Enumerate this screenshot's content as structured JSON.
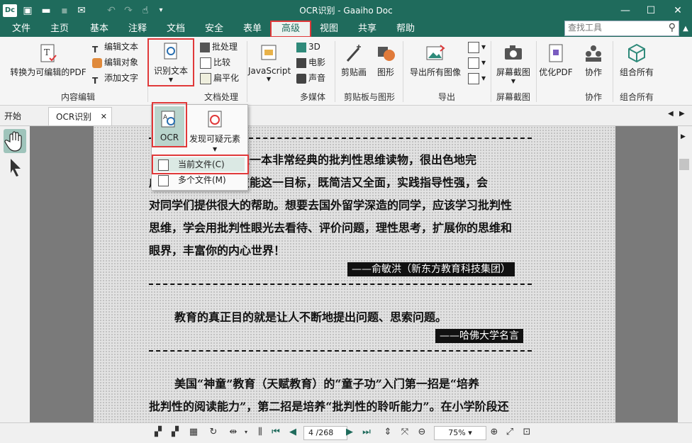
{
  "titlebar": {
    "logo": "Dc",
    "title": "OCR识别 - Gaaiho Doc",
    "minimize": "—",
    "maximize": "☐",
    "close": "✕"
  },
  "quick_access": [
    {
      "name": "new-doc-icon",
      "glyph": "▣"
    },
    {
      "name": "open-folder-icon",
      "glyph": "▬"
    },
    {
      "name": "save-icon",
      "glyph": "▪"
    },
    {
      "name": "email-icon",
      "glyph": "✉"
    },
    {
      "name": "undo-icon",
      "glyph": "↶"
    },
    {
      "name": "redo-icon",
      "glyph": "↷"
    },
    {
      "name": "hand-tool-icon",
      "glyph": "☝"
    },
    {
      "name": "customize-icon",
      "glyph": "▾"
    }
  ],
  "menu": {
    "items": [
      "文件",
      "主页",
      "基本",
      "注释",
      "文档",
      "安全",
      "表单",
      "高级",
      "视图",
      "共享",
      "帮助"
    ],
    "active": "高级",
    "search_placeholder": "查找工具"
  },
  "ribbon": {
    "convert_editable": "转换为可编辑的PDF",
    "edit_text": "编辑文本",
    "edit_object": "编辑对象",
    "add_text": "添加文字",
    "group_content_edit": "内容编辑",
    "ocr_text": "识别文本",
    "batch": "批处理",
    "compare": "比较",
    "flatten": "扁平化",
    "group_doc_process": "文档处理",
    "javascript": "JavaScript",
    "threed": "3D",
    "movie": "电影",
    "sound": "声音",
    "group_multimedia": "多媒体",
    "clip_art": "剪贴画",
    "shapes": "图形",
    "group_clip": "剪贴板与图形",
    "export_images": "导出所有图像",
    "group_export": "导出",
    "screenshot": "屏幕截图",
    "group_screenshot": "屏幕截图",
    "optimize": "优化PDF",
    "collab": "协作",
    "group_collab": "协作",
    "combine_all": "组合所有",
    "group_combine": "组合所有"
  },
  "tabs": {
    "start": "开始",
    "ocr": "OCR识别",
    "close": "✕"
  },
  "dropdown": {
    "ocr": "OCR",
    "find_suspects": "发现可疑元素",
    "current_file": "当前文件(C)",
    "multiple_files": "多个文件(M)"
  },
  "document": {
    "line1": "问》是一本非常经典的批判性思维读物，很出色地完",
    "line2a": "成",
    "line2b": "问的技能这一目标，既简洁又全面，实践指导性强，会",
    "line3": "对同学们提供很大的帮助。想要去国外留学深造的同学，应该学习批判性",
    "line4": "思维，学会用批判性眼光去看待、评价问题，理性思考，扩展你的思维和",
    "line5": "眼界，丰富你的内心世界！",
    "attribution1": "——俞敏洪（新东方教育科技集团）",
    "quote2": "教育的真正目的就是让人不断地提出问题、思索问题。",
    "attribution2": "——哈佛大学名言",
    "para3_1": "美国“神童”教育（天赋教育）的“童子功”入门第一招是“培养",
    "para3_2": "批判性的阅读能力”，第二招是培养“批判性的聆听能力”。在小学阶段还"
  },
  "statusbar": {
    "page_current": "4",
    "page_total": "/268",
    "zoom": "75%"
  },
  "colors": {
    "brand": "#1f6b5c",
    "highlight": "#e0393a"
  }
}
